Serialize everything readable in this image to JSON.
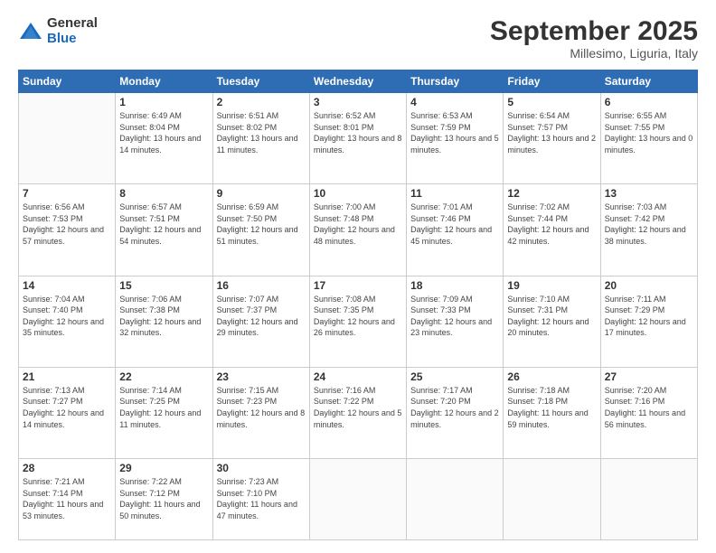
{
  "logo": {
    "general": "General",
    "blue": "Blue"
  },
  "header": {
    "month": "September 2025",
    "location": "Millesimo, Liguria, Italy"
  },
  "weekdays": [
    "Sunday",
    "Monday",
    "Tuesday",
    "Wednesday",
    "Thursday",
    "Friday",
    "Saturday"
  ],
  "weeks": [
    [
      {
        "day": "",
        "sunrise": "",
        "sunset": "",
        "daylight": ""
      },
      {
        "day": "1",
        "sunrise": "Sunrise: 6:49 AM",
        "sunset": "Sunset: 8:04 PM",
        "daylight": "Daylight: 13 hours and 14 minutes."
      },
      {
        "day": "2",
        "sunrise": "Sunrise: 6:51 AM",
        "sunset": "Sunset: 8:02 PM",
        "daylight": "Daylight: 13 hours and 11 minutes."
      },
      {
        "day": "3",
        "sunrise": "Sunrise: 6:52 AM",
        "sunset": "Sunset: 8:01 PM",
        "daylight": "Daylight: 13 hours and 8 minutes."
      },
      {
        "day": "4",
        "sunrise": "Sunrise: 6:53 AM",
        "sunset": "Sunset: 7:59 PM",
        "daylight": "Daylight: 13 hours and 5 minutes."
      },
      {
        "day": "5",
        "sunrise": "Sunrise: 6:54 AM",
        "sunset": "Sunset: 7:57 PM",
        "daylight": "Daylight: 13 hours and 2 minutes."
      },
      {
        "day": "6",
        "sunrise": "Sunrise: 6:55 AM",
        "sunset": "Sunset: 7:55 PM",
        "daylight": "Daylight: 13 hours and 0 minutes."
      }
    ],
    [
      {
        "day": "7",
        "sunrise": "Sunrise: 6:56 AM",
        "sunset": "Sunset: 7:53 PM",
        "daylight": "Daylight: 12 hours and 57 minutes."
      },
      {
        "day": "8",
        "sunrise": "Sunrise: 6:57 AM",
        "sunset": "Sunset: 7:51 PM",
        "daylight": "Daylight: 12 hours and 54 minutes."
      },
      {
        "day": "9",
        "sunrise": "Sunrise: 6:59 AM",
        "sunset": "Sunset: 7:50 PM",
        "daylight": "Daylight: 12 hours and 51 minutes."
      },
      {
        "day": "10",
        "sunrise": "Sunrise: 7:00 AM",
        "sunset": "Sunset: 7:48 PM",
        "daylight": "Daylight: 12 hours and 48 minutes."
      },
      {
        "day": "11",
        "sunrise": "Sunrise: 7:01 AM",
        "sunset": "Sunset: 7:46 PM",
        "daylight": "Daylight: 12 hours and 45 minutes."
      },
      {
        "day": "12",
        "sunrise": "Sunrise: 7:02 AM",
        "sunset": "Sunset: 7:44 PM",
        "daylight": "Daylight: 12 hours and 42 minutes."
      },
      {
        "day": "13",
        "sunrise": "Sunrise: 7:03 AM",
        "sunset": "Sunset: 7:42 PM",
        "daylight": "Daylight: 12 hours and 38 minutes."
      }
    ],
    [
      {
        "day": "14",
        "sunrise": "Sunrise: 7:04 AM",
        "sunset": "Sunset: 7:40 PM",
        "daylight": "Daylight: 12 hours and 35 minutes."
      },
      {
        "day": "15",
        "sunrise": "Sunrise: 7:06 AM",
        "sunset": "Sunset: 7:38 PM",
        "daylight": "Daylight: 12 hours and 32 minutes."
      },
      {
        "day": "16",
        "sunrise": "Sunrise: 7:07 AM",
        "sunset": "Sunset: 7:37 PM",
        "daylight": "Daylight: 12 hours and 29 minutes."
      },
      {
        "day": "17",
        "sunrise": "Sunrise: 7:08 AM",
        "sunset": "Sunset: 7:35 PM",
        "daylight": "Daylight: 12 hours and 26 minutes."
      },
      {
        "day": "18",
        "sunrise": "Sunrise: 7:09 AM",
        "sunset": "Sunset: 7:33 PM",
        "daylight": "Daylight: 12 hours and 23 minutes."
      },
      {
        "day": "19",
        "sunrise": "Sunrise: 7:10 AM",
        "sunset": "Sunset: 7:31 PM",
        "daylight": "Daylight: 12 hours and 20 minutes."
      },
      {
        "day": "20",
        "sunrise": "Sunrise: 7:11 AM",
        "sunset": "Sunset: 7:29 PM",
        "daylight": "Daylight: 12 hours and 17 minutes."
      }
    ],
    [
      {
        "day": "21",
        "sunrise": "Sunrise: 7:13 AM",
        "sunset": "Sunset: 7:27 PM",
        "daylight": "Daylight: 12 hours and 14 minutes."
      },
      {
        "day": "22",
        "sunrise": "Sunrise: 7:14 AM",
        "sunset": "Sunset: 7:25 PM",
        "daylight": "Daylight: 12 hours and 11 minutes."
      },
      {
        "day": "23",
        "sunrise": "Sunrise: 7:15 AM",
        "sunset": "Sunset: 7:23 PM",
        "daylight": "Daylight: 12 hours and 8 minutes."
      },
      {
        "day": "24",
        "sunrise": "Sunrise: 7:16 AM",
        "sunset": "Sunset: 7:22 PM",
        "daylight": "Daylight: 12 hours and 5 minutes."
      },
      {
        "day": "25",
        "sunrise": "Sunrise: 7:17 AM",
        "sunset": "Sunset: 7:20 PM",
        "daylight": "Daylight: 12 hours and 2 minutes."
      },
      {
        "day": "26",
        "sunrise": "Sunrise: 7:18 AM",
        "sunset": "Sunset: 7:18 PM",
        "daylight": "Daylight: 11 hours and 59 minutes."
      },
      {
        "day": "27",
        "sunrise": "Sunrise: 7:20 AM",
        "sunset": "Sunset: 7:16 PM",
        "daylight": "Daylight: 11 hours and 56 minutes."
      }
    ],
    [
      {
        "day": "28",
        "sunrise": "Sunrise: 7:21 AM",
        "sunset": "Sunset: 7:14 PM",
        "daylight": "Daylight: 11 hours and 53 minutes."
      },
      {
        "day": "29",
        "sunrise": "Sunrise: 7:22 AM",
        "sunset": "Sunset: 7:12 PM",
        "daylight": "Daylight: 11 hours and 50 minutes."
      },
      {
        "day": "30",
        "sunrise": "Sunrise: 7:23 AM",
        "sunset": "Sunset: 7:10 PM",
        "daylight": "Daylight: 11 hours and 47 minutes."
      },
      {
        "day": "",
        "sunrise": "",
        "sunset": "",
        "daylight": ""
      },
      {
        "day": "",
        "sunrise": "",
        "sunset": "",
        "daylight": ""
      },
      {
        "day": "",
        "sunrise": "",
        "sunset": "",
        "daylight": ""
      },
      {
        "day": "",
        "sunrise": "",
        "sunset": "",
        "daylight": ""
      }
    ]
  ]
}
